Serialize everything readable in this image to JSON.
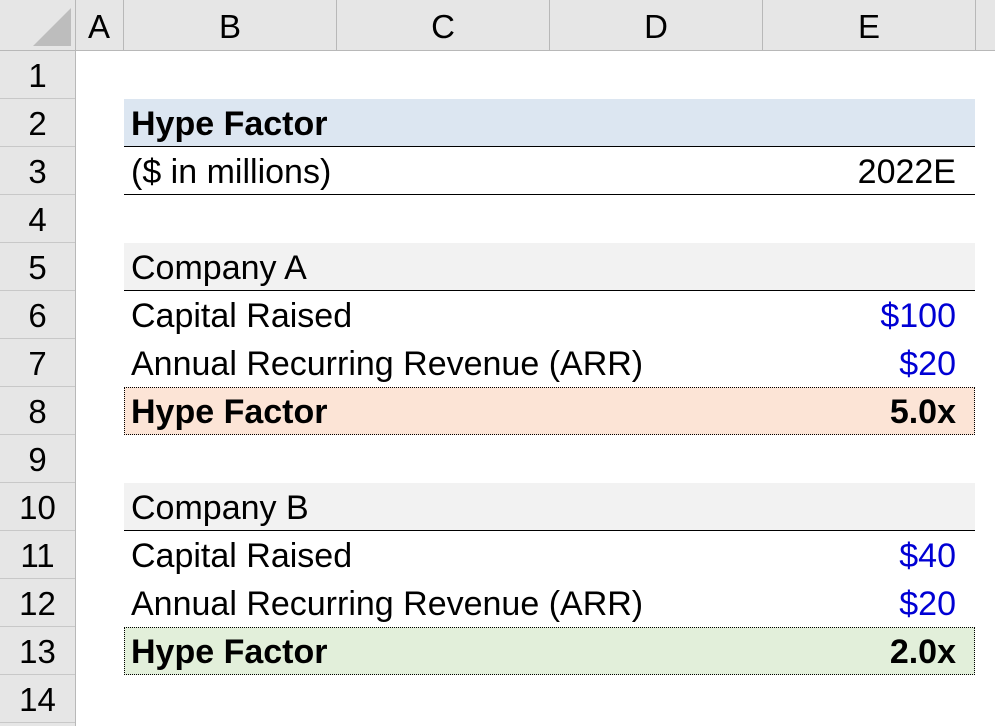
{
  "columns": [
    "A",
    "B",
    "C",
    "D",
    "E"
  ],
  "rows": [
    "1",
    "2",
    "3",
    "4",
    "5",
    "6",
    "7",
    "8",
    "9",
    "10",
    "11",
    "12",
    "13",
    "14"
  ],
  "title": "Hype Factor",
  "units": "($ in millions)",
  "year": "2022E",
  "company_a": {
    "name": "Company A",
    "capital_label": "Capital Raised",
    "capital_value": "$100",
    "arr_label": "Annual Recurring Revenue (ARR)",
    "arr_value": "$20",
    "hype_label": "Hype Factor",
    "hype_value": "5.0x"
  },
  "company_b": {
    "name": "Company B",
    "capital_label": "Capital Raised",
    "capital_value": "$40",
    "arr_label": "Annual Recurring Revenue (ARR)",
    "arr_value": "$20",
    "hype_label": "Hype Factor",
    "hype_value": "2.0x"
  },
  "colors": {
    "header_fill": "#dce6f1",
    "section_fill": "#f2f2f2",
    "hype_a_fill": "#fce4d6",
    "hype_b_fill": "#e2efda",
    "input_blue": "#0000d4"
  }
}
